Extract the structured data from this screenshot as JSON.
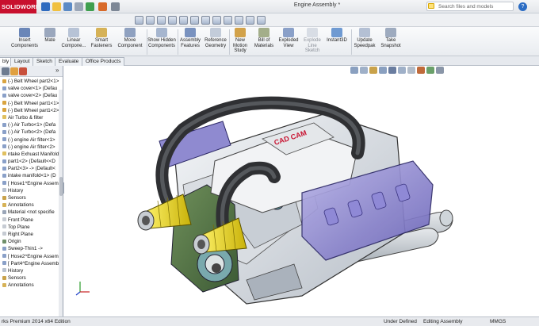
{
  "app": {
    "logo_text": "SOLIDWORKS",
    "document_title": "Engine Assembly *",
    "search_placeholder": "Search files and models",
    "brand_color": "#c8102e"
  },
  "command_manager": [
    {
      "label": "Insert Components",
      "icon": "insert-components-icon"
    },
    {
      "label": "Mate",
      "icon": "mate-icon"
    },
    {
      "label": "Linear Compone...",
      "icon": "linear-pattern-icon"
    },
    {
      "label": "Smart Fasteners",
      "icon": "smart-fasteners-icon"
    },
    {
      "label": "Move Component",
      "icon": "move-component-icon"
    },
    {
      "label": "Show Hidden Components",
      "icon": "show-hidden-icon"
    },
    {
      "label": "Assembly Features",
      "icon": "assembly-features-icon"
    },
    {
      "label": "Reference Geometry",
      "icon": "reference-geometry-icon"
    },
    {
      "label": "New Motion Study",
      "icon": "motion-study-icon"
    },
    {
      "label": "Bill of Materials",
      "icon": "bom-icon"
    },
    {
      "label": "Exploded View",
      "icon": "exploded-view-icon"
    },
    {
      "label": "Explode Line Sketch",
      "icon": "explode-line-icon"
    },
    {
      "label": "Instant3D",
      "icon": "instant3d-icon"
    },
    {
      "label": "Update Speedpak",
      "icon": "speedpak-icon"
    },
    {
      "label": "Take Snapshot",
      "icon": "snapshot-icon"
    }
  ],
  "tabs": [
    "Assembly",
    "Layout",
    "Sketch",
    "Evaluate",
    "Office Products"
  ],
  "active_tab": "Assembly",
  "tabs_visible": [
    "bly",
    "Layout",
    "Sketch",
    "Evaluate",
    "Office Products"
  ],
  "tree_items": [
    "(-) Belt Wheel part2<1>",
    "valve cover<1> (Defau",
    "valve cover<2> (Defau",
    "(-) Belt Wheel part1<1>",
    "(-) Belt Wheel part1<2>",
    "Air Turbo & filter",
    "(-) Air Turbo<1> (Defa",
    "(-) Air Turbo<2> (Defa",
    "(-) engine Air filter<1>",
    "(-) engine Air filter<2>",
    "ntake Exhuast Manifold",
    "part1<2> (Default<<D",
    "Part2<3> -> (Default<",
    "intake manifold<1> (D",
    "[ Hose1^Engine Assem",
    "History",
    "Sensors",
    "Annotations",
    "Material <not specifie",
    "Front Plane",
    "Top Plane",
    "Right Plane",
    "Origin",
    "Sweep-Thin1 ->",
    "[ Hose2^Engine Assem",
    "[ Part4^Engine Assemb",
    "History",
    "Sensors",
    "Annotations"
  ],
  "status_bar": {
    "edition": "rks Premium 2014 x64 Edition",
    "definition": "Under Defined",
    "mode": "Editing Assembly",
    "units": "MMGS"
  }
}
